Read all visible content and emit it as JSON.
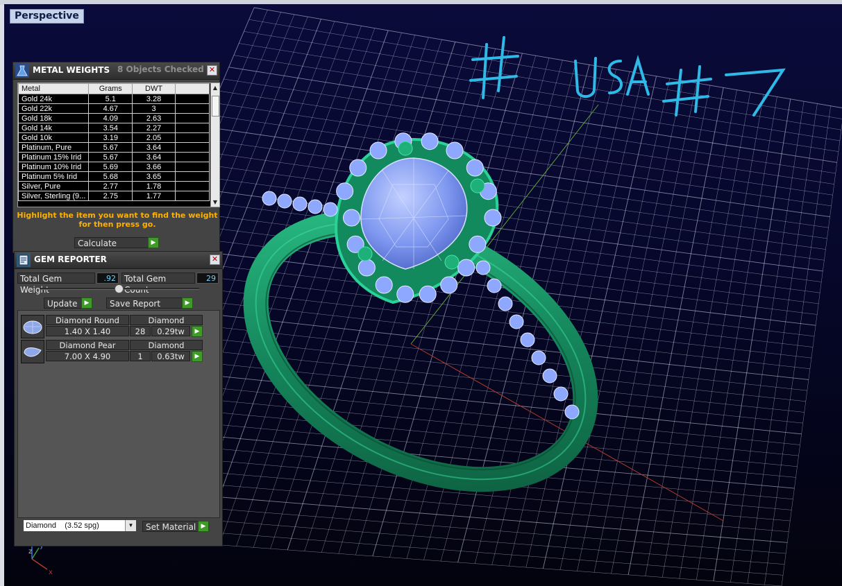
{
  "viewport": {
    "label": "Perspective"
  },
  "annotation": {
    "text": "# USA #7"
  },
  "colors": {
    "ring": "#1f9a6b",
    "gem": "#8fa8ff",
    "grid": "#d8dff0",
    "annotation": "#2fb9e6",
    "go": "#3f9a28"
  },
  "metal_weights": {
    "title": "METAL WEIGHTS",
    "subtitle": "8 Objects Checked",
    "columns": [
      "Metal",
      "Grams",
      "DWT"
    ],
    "rows": [
      {
        "metal": "Gold 24k",
        "grams": "5.1",
        "dwt": "3.28"
      },
      {
        "metal": "Gold 22k",
        "grams": "4.67",
        "dwt": "3"
      },
      {
        "metal": "Gold 18k",
        "grams": "4.09",
        "dwt": "2.63"
      },
      {
        "metal": "Gold 14k",
        "grams": "3.54",
        "dwt": "2.27"
      },
      {
        "metal": "Gold 10k",
        "grams": "3.19",
        "dwt": "2.05"
      },
      {
        "metal": "Platinum, Pure",
        "grams": "5.67",
        "dwt": "3.64"
      },
      {
        "metal": "Platinum 15% Irid",
        "grams": "5.67",
        "dwt": "3.64"
      },
      {
        "metal": "Platinum 10% Irid",
        "grams": "5.69",
        "dwt": "3.66"
      },
      {
        "metal": "Platinum 5% Irid",
        "grams": "5.68",
        "dwt": "3.65"
      },
      {
        "metal": "Silver, Pure",
        "grams": "2.77",
        "dwt": "1.78"
      },
      {
        "metal": "Silver, Sterling (9...",
        "grams": "2.75",
        "dwt": "1.77"
      }
    ],
    "instructions": "Highlight the item you want to find the weight for then press go.",
    "calculate_label": "Calculate"
  },
  "gem_reporter": {
    "title": "GEM REPORTER",
    "total_weight_label": "Total Gem Weight",
    "total_weight_value": ".92",
    "total_count_label": "Total Gem Count",
    "total_count_value": "29",
    "update_label": "Update",
    "save_report_label": "Save Report",
    "gems": [
      {
        "name": "Diamond Round",
        "material": "Diamond",
        "size": "1.40 X 1.40",
        "count": "28",
        "weight": "0.29tw"
      },
      {
        "name": "Diamond Pear",
        "material": "Diamond",
        "size": "7.00 X 4.90",
        "count": "1",
        "weight": "0.63tw"
      }
    ],
    "material_select": "Diamond    (3.52 spg)",
    "set_material_label": "Set Material"
  },
  "axis": {
    "x": "x",
    "y": "y",
    "z": "z"
  }
}
